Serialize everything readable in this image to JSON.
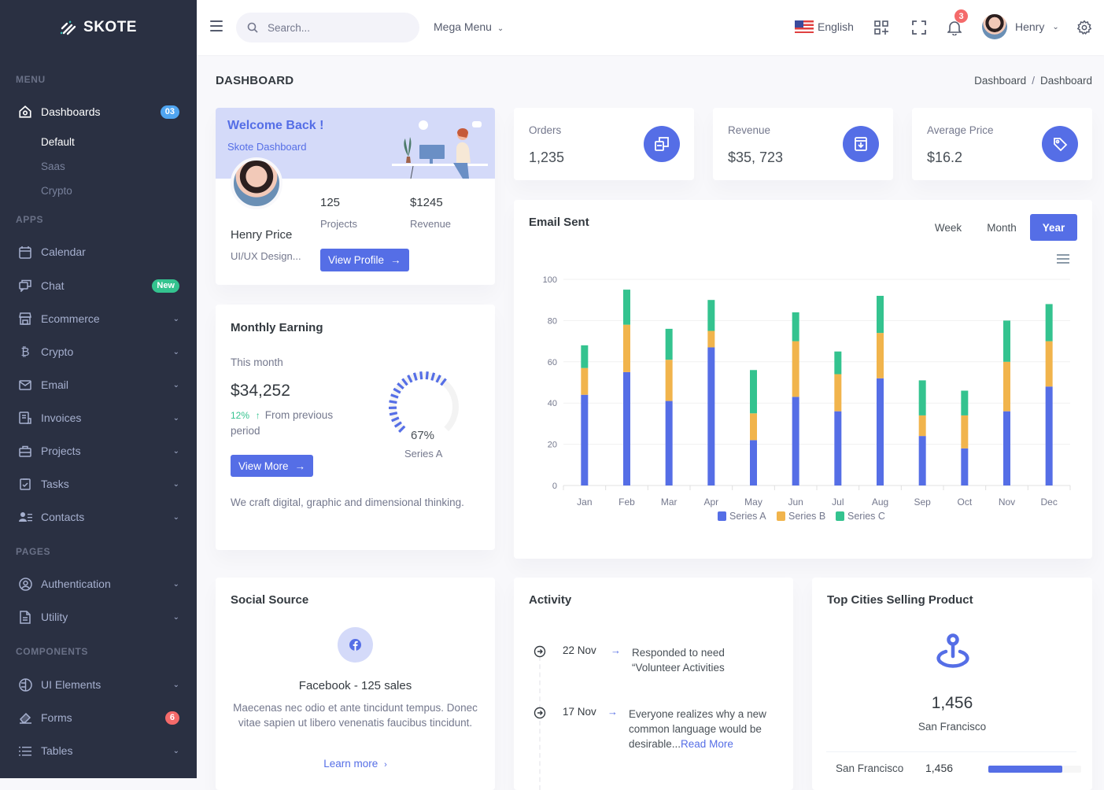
{
  "sidebar": {
    "brand": "SKOTE",
    "sections": {
      "menu": "MENU",
      "apps": "APPS",
      "pages": "PAGES",
      "components": "COMPONENTS"
    },
    "dashboards": {
      "label": "Dashboards",
      "badge": "03",
      "badge_color": "#50a5f1"
    },
    "dashboard_sub": [
      "Default",
      "Saas",
      "Crypto"
    ],
    "apps": [
      {
        "label": "Calendar",
        "icon": "calendar-icon"
      },
      {
        "label": "Chat",
        "icon": "chat-icon",
        "badge": "New",
        "badge_color": "#34c38f"
      },
      {
        "label": "Ecommerce",
        "icon": "store-icon",
        "has_children": true
      },
      {
        "label": "Crypto",
        "icon": "bitcoin-icon",
        "has_children": true
      },
      {
        "label": "Email",
        "icon": "envelope-icon",
        "has_children": true
      },
      {
        "label": "Invoices",
        "icon": "invoice-icon",
        "has_children": true
      },
      {
        "label": "Projects",
        "icon": "briefcase-icon",
        "has_children": true
      },
      {
        "label": "Tasks",
        "icon": "task-icon",
        "has_children": true
      },
      {
        "label": "Contacts",
        "icon": "contacts-icon",
        "has_children": true
      }
    ],
    "pages": [
      {
        "label": "Authentication",
        "icon": "user-circle-icon",
        "has_children": true
      },
      {
        "label": "Utility",
        "icon": "file-icon",
        "has_children": true
      }
    ],
    "components": [
      {
        "label": "UI Elements",
        "icon": "ui-elements-icon",
        "has_children": true
      },
      {
        "label": "Forms",
        "icon": "eraser-icon",
        "badge": "6",
        "badge_color": "#f46a6a"
      },
      {
        "label": "Tables",
        "icon": "list-icon",
        "has_children": true
      }
    ]
  },
  "topbar": {
    "search_placeholder": "Search...",
    "mega_menu": "Mega Menu",
    "language": "English",
    "notification_count": "3",
    "user_name": "Henry"
  },
  "page": {
    "title": "DASHBOARD",
    "breadcrumb": [
      "Dashboard",
      "Dashboard"
    ]
  },
  "welcome": {
    "title": "Welcome Back !",
    "subtitle": "Skote Dashboard",
    "name": "Henry Price",
    "role": "UI/UX Design...",
    "projects_value": "125",
    "projects_label": "Projects",
    "revenue_value": "$1245",
    "revenue_label": "Revenue",
    "button": "View Profile"
  },
  "stats": [
    {
      "label": "Orders",
      "value": "1,235",
      "icon": "copy-icon"
    },
    {
      "label": "Revenue",
      "value": "$35, 723",
      "icon": "archive-icon"
    },
    {
      "label": "Average Price",
      "value": "$16.2",
      "icon": "tag-icon"
    }
  ],
  "monthly_earning": {
    "title": "Monthly Earning",
    "period_label": "This month",
    "amount": "$34,252",
    "change": "12%",
    "change_text": "From previous period",
    "button": "View More",
    "gauge_value": 67,
    "gauge_label": "67%",
    "gauge_series": "Series A",
    "footer": "We craft digital, graphic and dimensional thinking."
  },
  "email_sent": {
    "title": "Email Sent",
    "periods": [
      "Week",
      "Month",
      "Year"
    ],
    "active_period": "Year"
  },
  "chart_data": {
    "type": "bar",
    "stacked": true,
    "title": "Email Sent",
    "categories": [
      "Jan",
      "Feb",
      "Mar",
      "Apr",
      "May",
      "Jun",
      "Jul",
      "Aug",
      "Sep",
      "Oct",
      "Nov",
      "Dec"
    ],
    "series": [
      {
        "name": "Series A",
        "color": "#556ee6",
        "values": [
          44,
          55,
          41,
          67,
          22,
          43,
          36,
          52,
          24,
          18,
          36,
          48
        ]
      },
      {
        "name": "Series B",
        "color": "#f1b44c",
        "values": [
          13,
          23,
          20,
          8,
          13,
          27,
          18,
          22,
          10,
          16,
          24,
          22
        ]
      },
      {
        "name": "Series C",
        "color": "#34c38f",
        "values": [
          11,
          17,
          15,
          15,
          21,
          14,
          11,
          18,
          17,
          12,
          20,
          18
        ]
      }
    ],
    "yticks": [
      "0",
      "20",
      "40",
      "60",
      "80",
      "100"
    ],
    "ylim": [
      0,
      100
    ],
    "grid": true,
    "legend": "bottom-center",
    "xlabel": "",
    "ylabel": ""
  },
  "social": {
    "title": "Social Source",
    "headline_name": "Facebook",
    "headline_sales": "125 sales",
    "description": "Maecenas nec odio et ante tincidunt tempus. Donec vitae sapien ut libero venenatis faucibus tincidunt.",
    "link": "Learn more"
  },
  "activity": {
    "title": "Activity",
    "items": [
      {
        "date": "22 Nov",
        "text": "Responded to need “Volunteer Activities",
        "link": ""
      },
      {
        "date": "17 Nov",
        "text": "Everyone realizes why a new common language would be desirable...",
        "link": "Read More"
      }
    ]
  },
  "top_cities": {
    "title": "Top Cities Selling Product",
    "value": "1,456",
    "city": "San Francisco",
    "rows": [
      {
        "city": "San Francisco",
        "value": "1,456",
        "progress": 0.8
      }
    ]
  },
  "colors": {
    "primary": "#556ee6",
    "success": "#34c38f",
    "warning": "#f1b44c",
    "danger": "#f46a6a",
    "info": "#50a5f1",
    "sidebar_bg": "#2a3042"
  }
}
